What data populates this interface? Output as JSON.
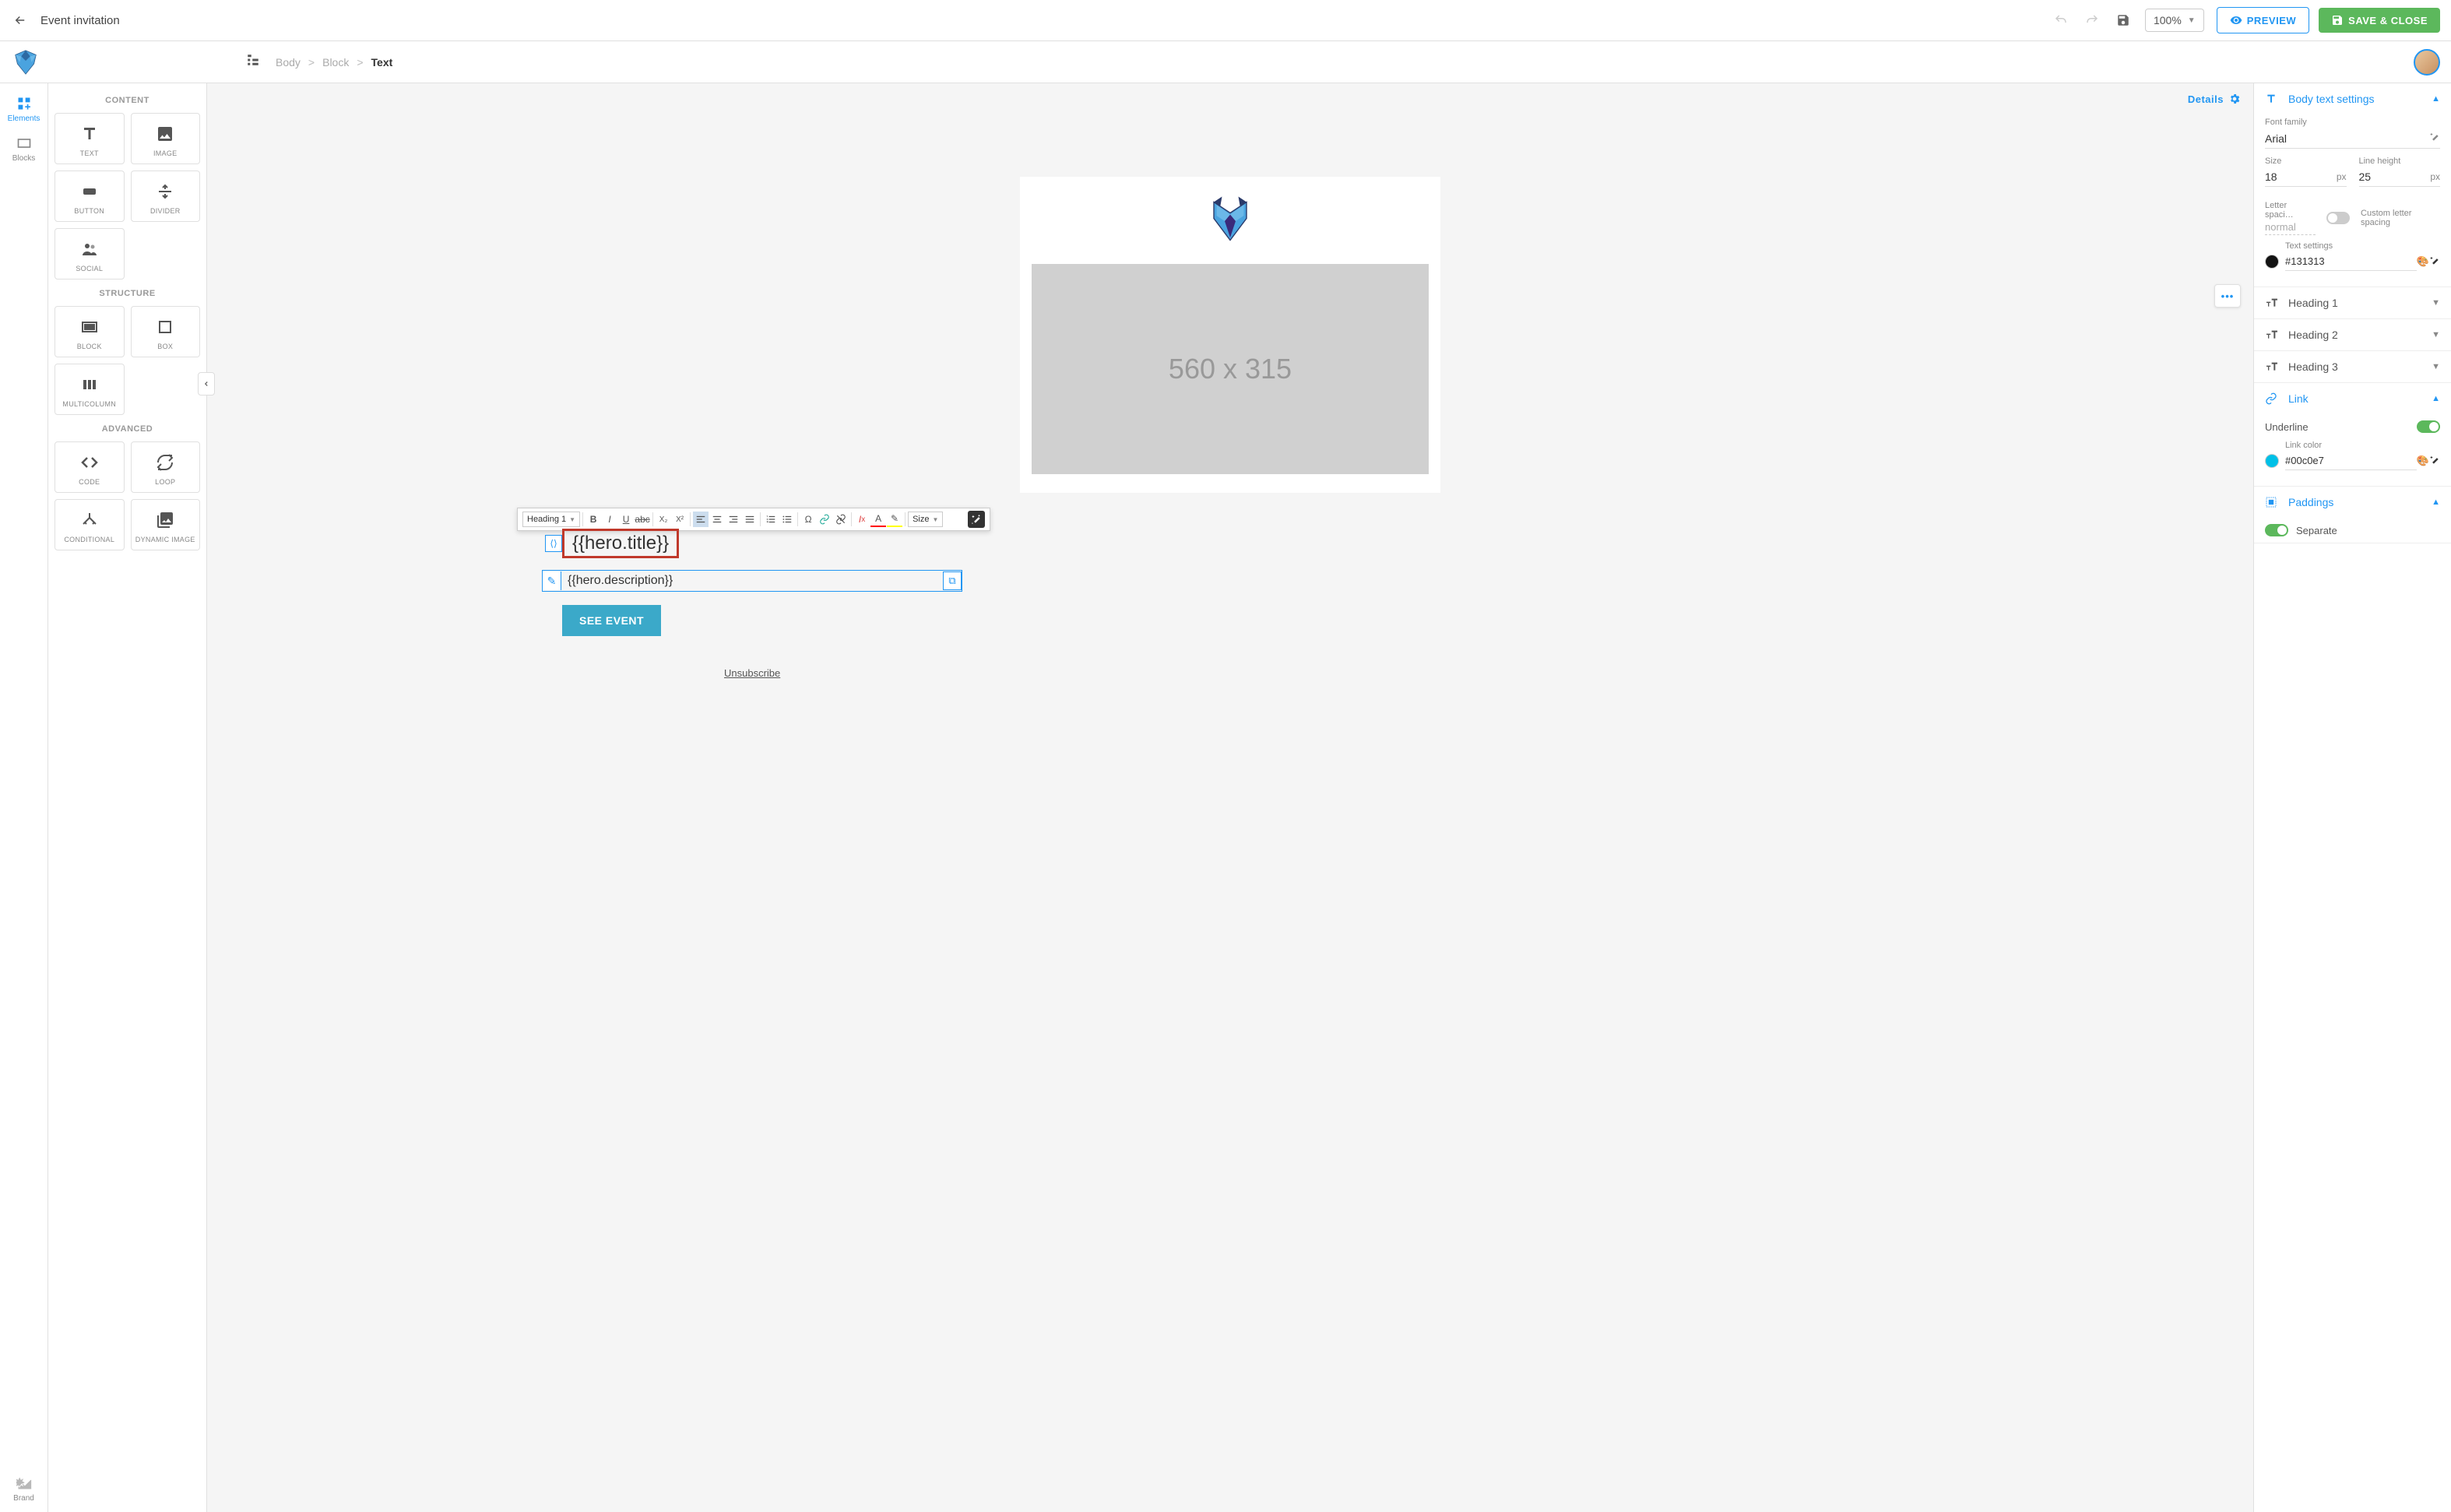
{
  "topbar": {
    "title": "Event invitation",
    "zoom": "100%",
    "preview_label": "PREVIEW",
    "save_label": "SAVE & CLOSE"
  },
  "breadcrumb": {
    "items": [
      "Body",
      "Block",
      "Text"
    ],
    "active_index": 2
  },
  "leftrail": {
    "tabs": [
      {
        "label": "Elements",
        "active": true
      },
      {
        "label": "Blocks",
        "active": false
      }
    ],
    "brand_label": "Brand"
  },
  "elements_panel": {
    "sections": {
      "content": {
        "title": "CONTENT",
        "items": [
          "TEXT",
          "IMAGE",
          "BUTTON",
          "DIVIDER",
          "SOCIAL"
        ]
      },
      "structure": {
        "title": "STRUCTURE",
        "items": [
          "BLOCK",
          "BOX",
          "MULTICOLUMN"
        ]
      },
      "advanced": {
        "title": "ADVANCED",
        "items": [
          "CODE",
          "LOOP",
          "CONDITIONAL",
          "DYNAMIC IMAGE"
        ]
      }
    }
  },
  "canvas": {
    "details_label": "Details",
    "hero_placeholder": "560 x 315",
    "hero_title": "{{hero.title}}",
    "hero_description": "{{hero.description}}",
    "cta_label": "SEE EVENT",
    "unsubscribe_label": "Unsubscribe",
    "text_toolbar": {
      "heading": "Heading 1",
      "size_label": "Size"
    }
  },
  "right_panel": {
    "body_text": {
      "title": "Body text settings",
      "font_family_label": "Font family",
      "font_family_value": "Arial",
      "size_label": "Size",
      "size_value": "18",
      "size_unit": "px",
      "line_height_label": "Line height",
      "line_height_value": "25",
      "line_height_unit": "px",
      "letter_spacing_label": "Letter spaci…",
      "letter_spacing_value": "normal",
      "custom_letter_spacing_label": "Custom letter spacing",
      "text_settings_label": "Text settings",
      "text_color": "#131313"
    },
    "heading1": {
      "title": "Heading 1"
    },
    "heading2": {
      "title": "Heading 2"
    },
    "heading3": {
      "title": "Heading 3"
    },
    "link": {
      "title": "Link",
      "underline_label": "Underline",
      "underline_on": true,
      "link_color_label": "Link color",
      "link_color": "#00c0e7"
    },
    "paddings": {
      "title": "Paddings",
      "separate_label": "Separate",
      "separate_on": true
    }
  }
}
